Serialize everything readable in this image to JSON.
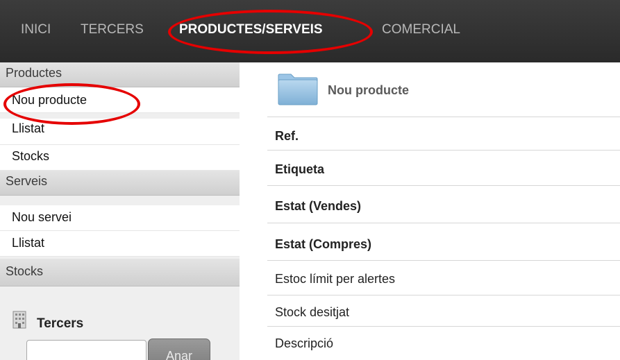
{
  "topnav": {
    "items": [
      "INICI",
      "TERCERS",
      "PRODUCTES/SERVEIS",
      "COMERCIAL"
    ],
    "active_index": 2
  },
  "sidebar": {
    "productes_header": "Productes",
    "productes_links": [
      "Nou producte",
      "Llistat",
      "Stocks"
    ],
    "serveis_header": "Serveis",
    "serveis_links": [
      "Nou servei",
      "Llistat"
    ],
    "stocks_header": "Stocks",
    "tercers": {
      "title": "Tercers",
      "search_value": "",
      "button_label": "Anar"
    }
  },
  "main": {
    "title": "Nou producte",
    "icon": "folder-icon",
    "fields": [
      {
        "label": "Ref.",
        "bold": true
      },
      {
        "label": "Etiqueta",
        "bold": true
      },
      {
        "label": "Estat (Vendes)",
        "bold": true
      },
      {
        "label": "Estat (Compres)",
        "bold": true
      },
      {
        "label": "Estoc límit per alertes",
        "bold": false
      },
      {
        "label": "Stock desitjat",
        "bold": false
      },
      {
        "label": "Descripció",
        "bold": false
      }
    ]
  },
  "annotations": {
    "highlight_color": "#e50000"
  },
  "colors": {
    "nav_bg": "#2f2f2f",
    "nav_text": "#b8b8b8",
    "nav_active": "#ffffff",
    "sidebar_header_bg": "#d8d8d8",
    "button_bg": "#8a8a8a"
  }
}
